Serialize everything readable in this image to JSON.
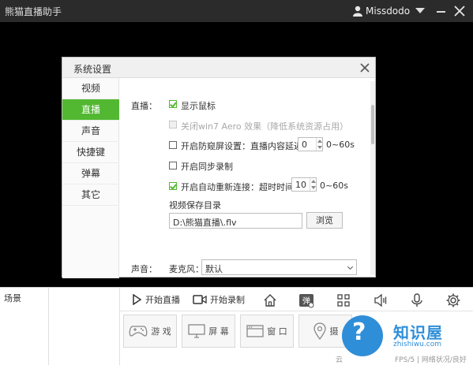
{
  "titlebar": {
    "app_title": "熊猫直播助手",
    "username": "Missdodo"
  },
  "dialog": {
    "title": "系统设置",
    "nav": [
      {
        "label": "视频",
        "active": false
      },
      {
        "label": "直播",
        "active": true
      },
      {
        "label": "声音",
        "active": false
      },
      {
        "label": "快捷键",
        "active": false
      },
      {
        "label": "弹幕",
        "active": false
      },
      {
        "label": "其它",
        "active": false
      }
    ],
    "section_label": "直播：",
    "options": {
      "show_mouse": {
        "label": "显示鼠标",
        "checked": true
      },
      "disable_aero": {
        "label": "关闭win7 Aero 效果（降低系统资源占用）",
        "checked": false,
        "disabled": true
      },
      "anti_peek": {
        "label": "开启防窥屏设置：直播内容延迟",
        "checked": false,
        "value": "0",
        "range": "0~60s"
      },
      "sync_record": {
        "label": "开启同步录制",
        "checked": false
      },
      "auto_reconnect": {
        "label": "开启自动重新连接：超时时间",
        "checked": true,
        "value": "10",
        "range": "0~60s"
      }
    },
    "save_dir": {
      "label": "视频保存目录",
      "value": "D:\\熊猫直播\\.flv",
      "browse_label": "浏览"
    },
    "sound": {
      "section_label": "声音：",
      "mic_label": "麦克风：",
      "mic_value": "默认"
    }
  },
  "bottom": {
    "scene_label": "场景",
    "start_live": "开始直播",
    "start_record": "开始录制",
    "sources": [
      {
        "label": "游 戏",
        "icon": "gamepad-icon"
      },
      {
        "label": "屏 幕",
        "icon": "monitor-icon"
      },
      {
        "label": "窗 口",
        "icon": "window-icon"
      },
      {
        "label": "摄",
        "icon": "location-icon"
      }
    ],
    "status_left": "云",
    "status_right": "FPS/5 | 网络状况/良好"
  },
  "watermark": {
    "badge": "?",
    "title": "知识屋",
    "url": "zhishiwu.com"
  },
  "colors": {
    "accent": "#52b831",
    "titlebar": "#2b2b2b",
    "watermark": "#2f8ed8"
  }
}
